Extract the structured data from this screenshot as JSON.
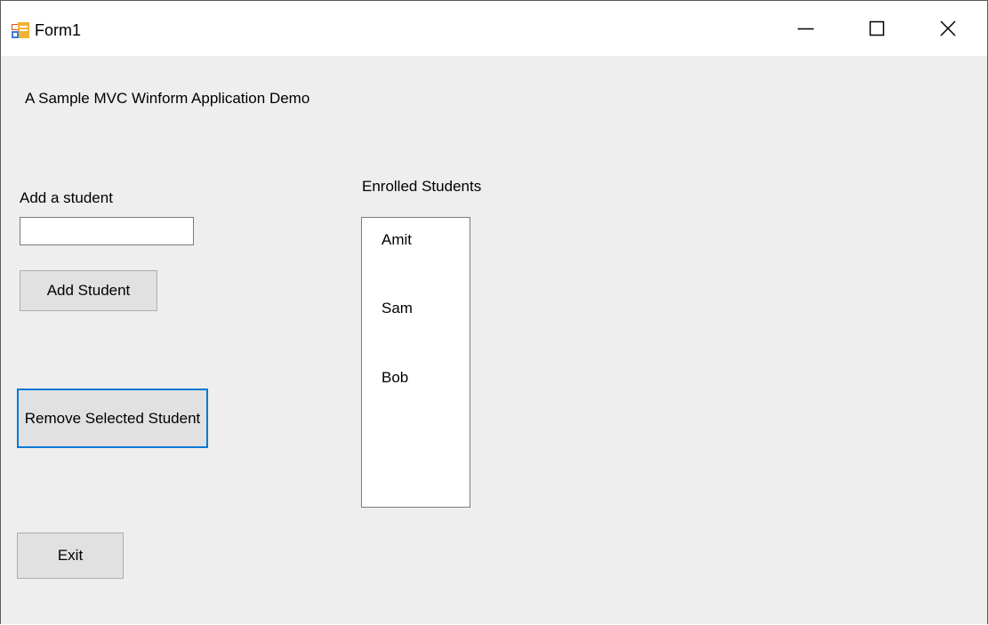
{
  "window": {
    "title": "Form1",
    "controls": {
      "minimize_icon": "minimize-icon",
      "maximize_icon": "maximize-icon",
      "close_icon": "close-icon"
    }
  },
  "form": {
    "heading": "A Sample MVC Winform Application Demo",
    "add_label": "Add a student",
    "student_input_value": "",
    "add_button": "Add Student",
    "remove_button": "Remove Selected Student",
    "exit_button": "Exit",
    "list_label": "Enrolled Students",
    "students": [
      "Amit",
      "Sam",
      "Bob"
    ]
  },
  "colors": {
    "background": "#eeeeee",
    "titlebar": "#ffffff",
    "focus_border": "#0078d7",
    "button_face": "#e1e1e1"
  }
}
